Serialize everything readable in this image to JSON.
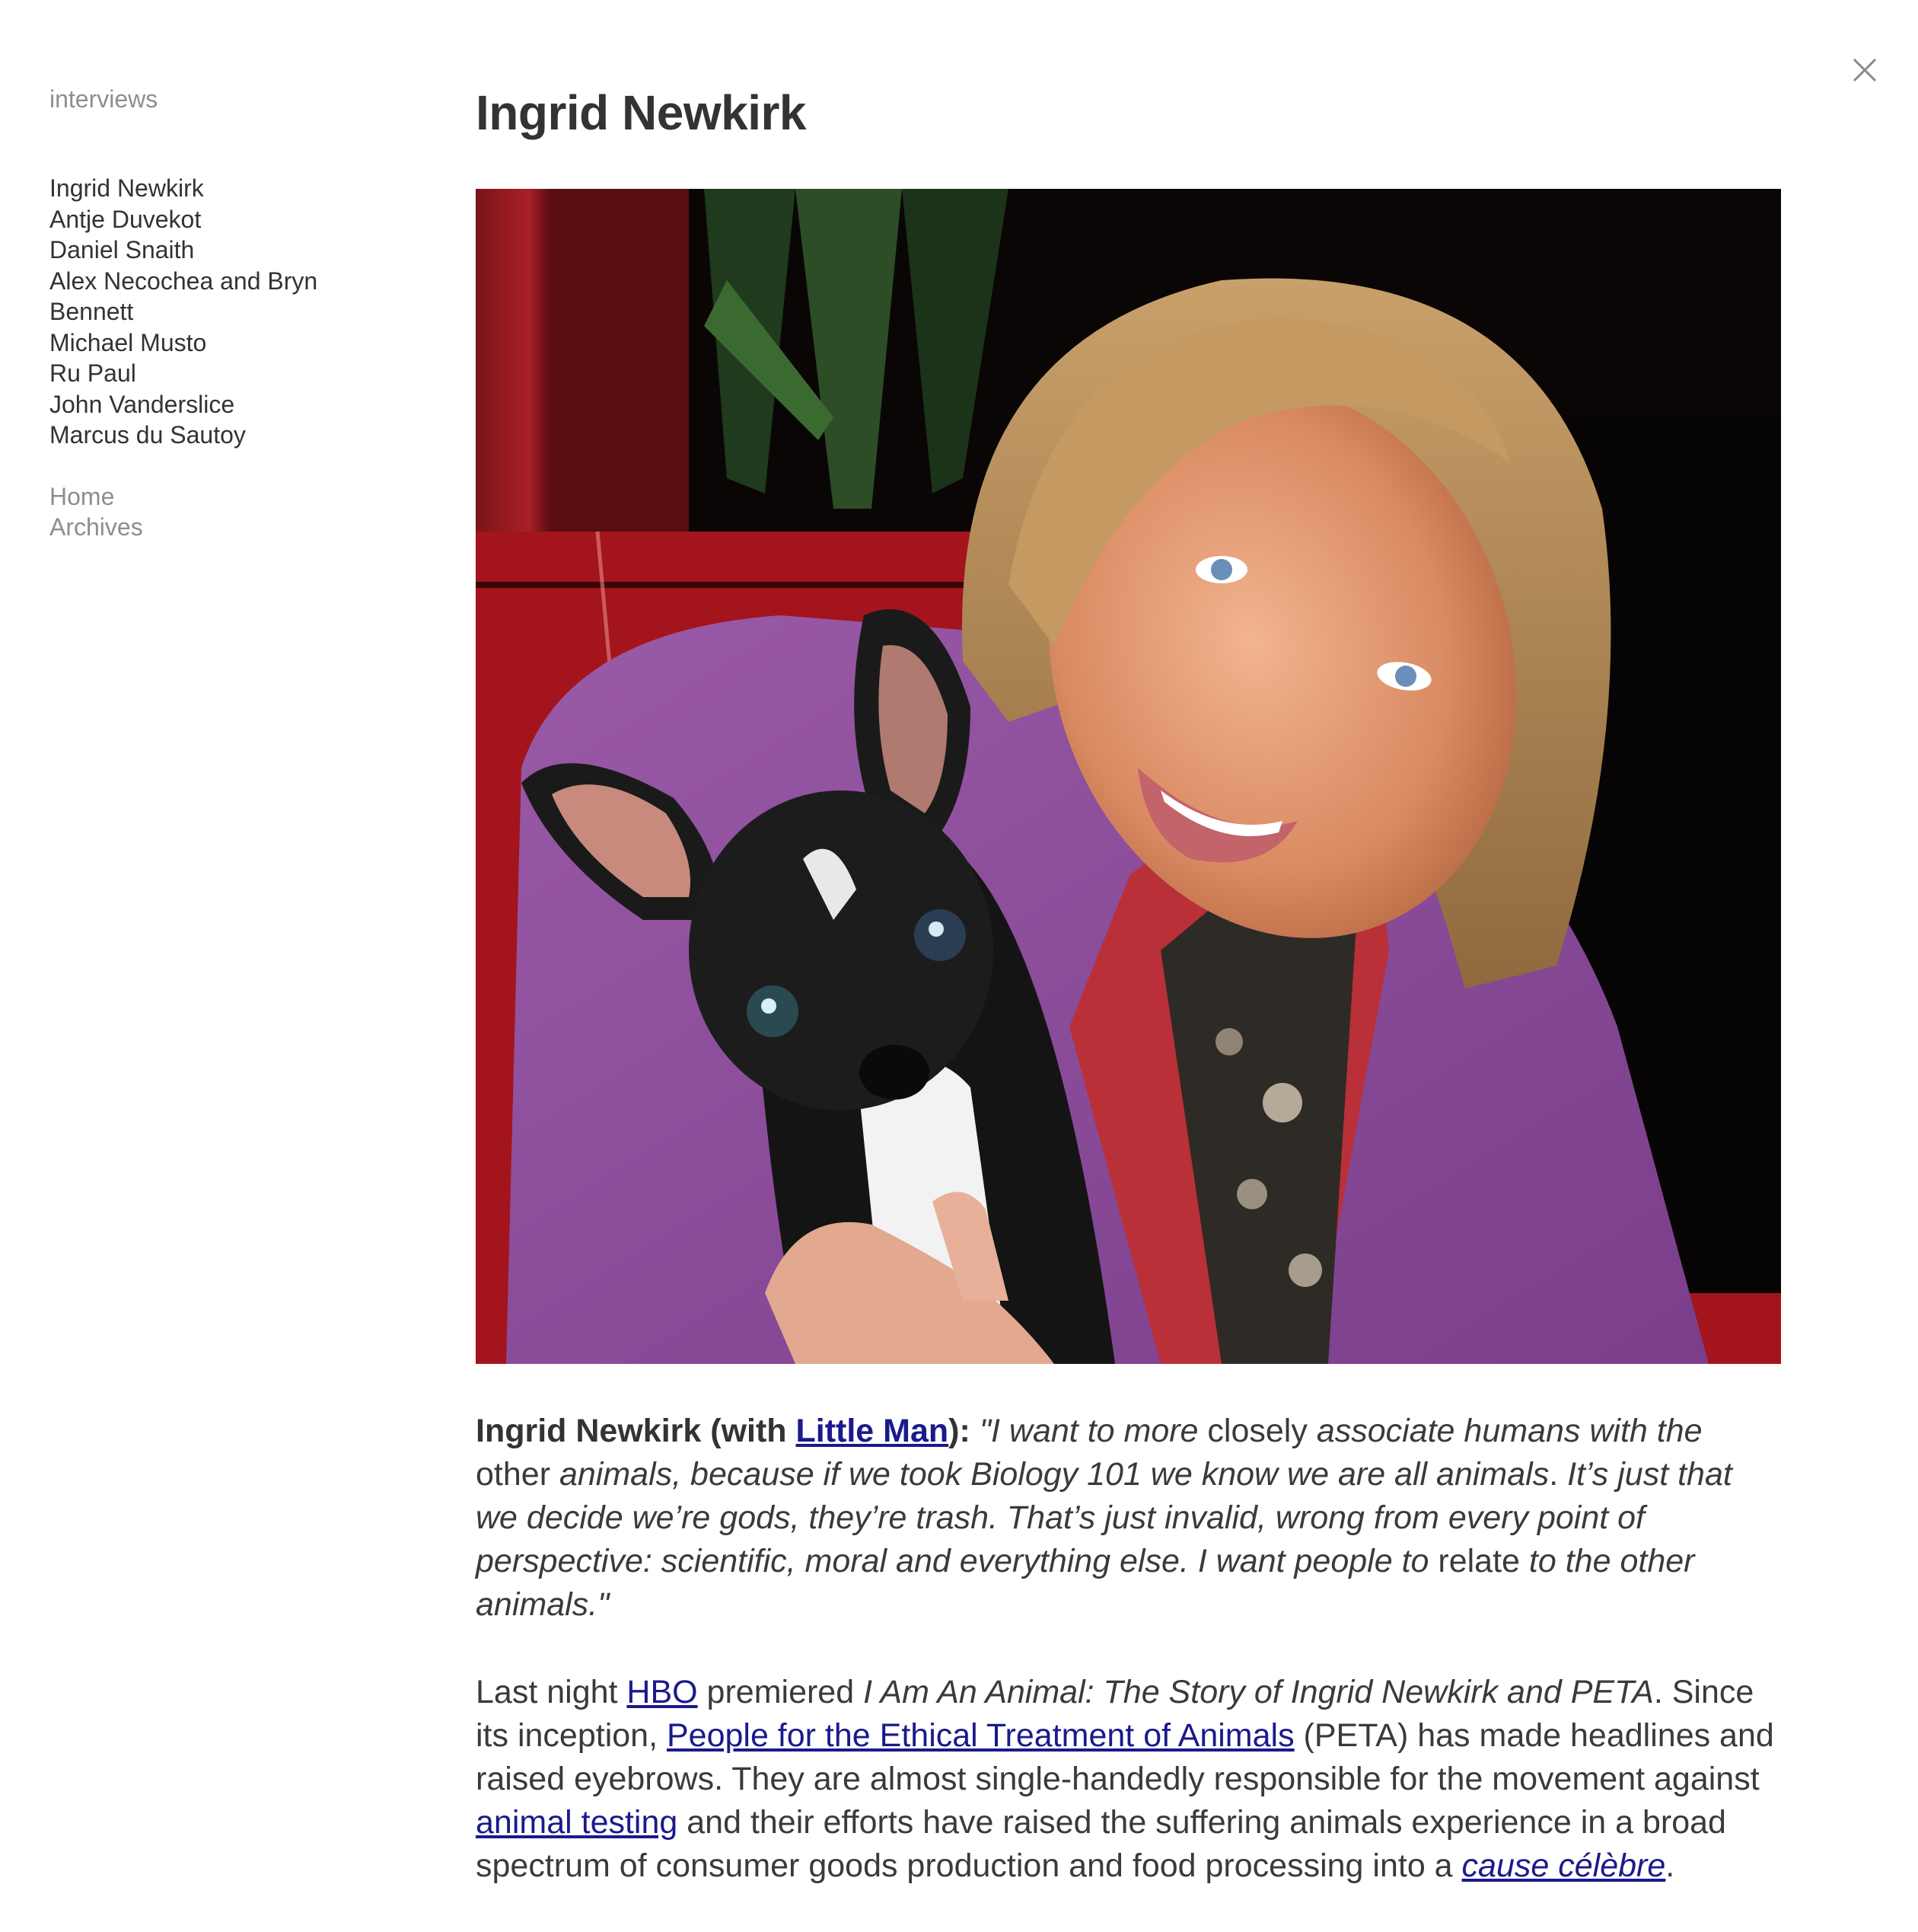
{
  "sidebar": {
    "section_label": "interviews",
    "items": [
      {
        "label": "Ingrid Newkirk"
      },
      {
        "label": "Antje Duvekot"
      },
      {
        "label": "Daniel Snaith"
      },
      {
        "label": "Alex Necochea and Bryn"
      },
      {
        "label": "Bennett"
      },
      {
        "label": "Michael Musto"
      },
      {
        "label": "Ru Paul"
      },
      {
        "label": "John Vanderslice"
      },
      {
        "label": "Marcus du Sautoy"
      }
    ],
    "links": [
      {
        "label": "Home"
      },
      {
        "label": "Archives"
      }
    ]
  },
  "close": {
    "icon": "close-icon"
  },
  "page": {
    "title": "Ingrid Newkirk"
  },
  "colors": {
    "link": "#1a1a8c",
    "text": "#3a3a3a",
    "muted": "#8e8e8e"
  },
  "article": {
    "quote": {
      "speaker": "Ingrid Newkirk (with ",
      "speaker_link": "Little Man",
      "speaker_end": "):",
      "t1": " \"I want to more",
      "t2": " closely ",
      "t3": "associate humans with the",
      "t4": " other ",
      "t5": "animals, because if we took Biology 101 we know we are all animals",
      "t6": ". ",
      "t7": "It’s just that we decide we’re gods, they’re trash. That’s just invalid, wrong from every point of perspective: scientific, moral and everything else. I want people to",
      "t8": " relate ",
      "t9": "to the other animals.",
      "t10": "\""
    },
    "para2": {
      "t1": "Last night ",
      "link1": "HBO",
      "t2": " premiered ",
      "film": "I Am An Animal: The Story of Ingrid Newkirk and PETA",
      "t3": ". Since its inception, ",
      "link2": "People for the Ethical Treatment of Animals",
      "t4": " (PETA) has made headlines and raised eyebrows. They are almost single-handedly responsible for the movement against ",
      "link3": "animal testing",
      "t5": " and their efforts have raised the suffering animals experience in a broad spectrum of consumer goods production and food processing into a ",
      "link4": "cause célèbre",
      "t6": "."
    }
  }
}
